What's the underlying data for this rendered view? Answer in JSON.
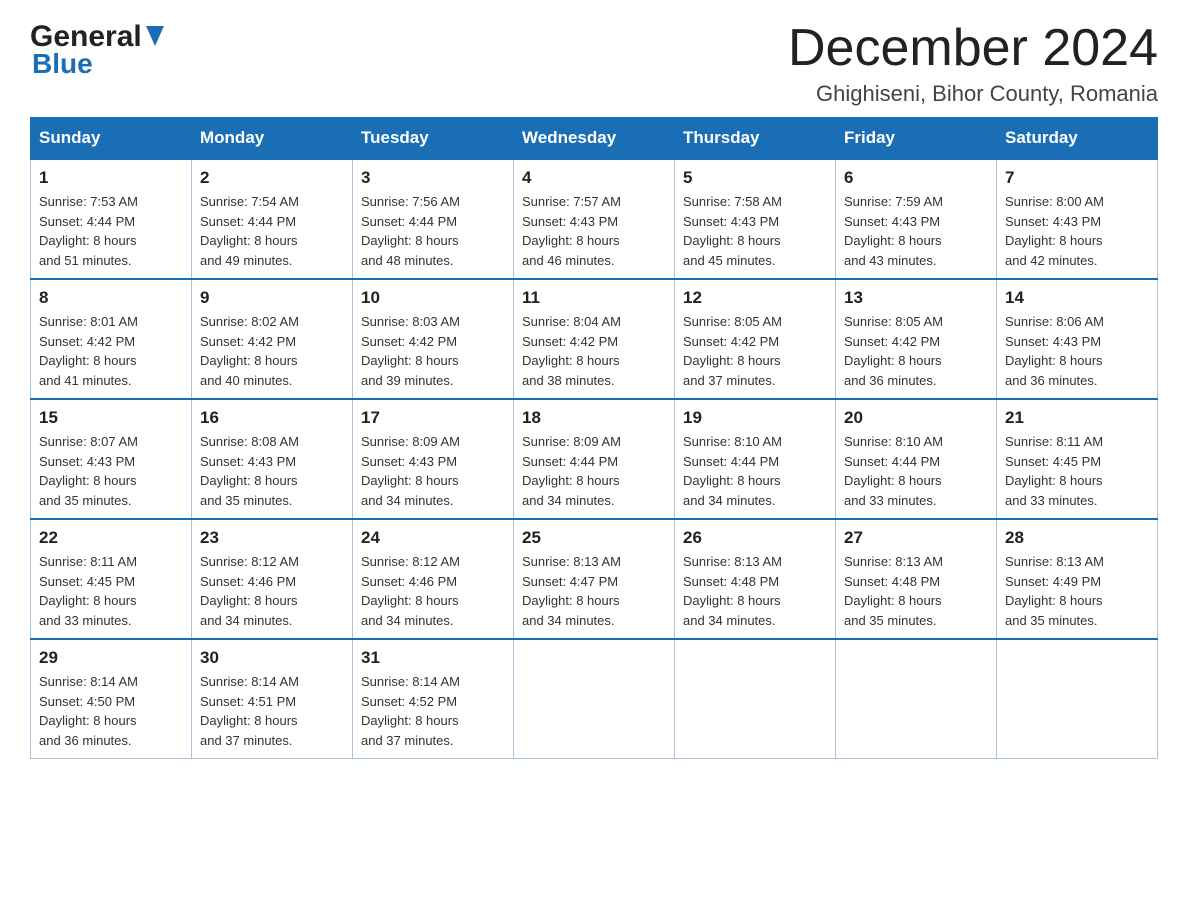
{
  "header": {
    "logo_general": "General",
    "logo_blue": "Blue",
    "month_title": "December 2024",
    "location": "Ghighiseni, Bihor County, Romania"
  },
  "weekdays": [
    "Sunday",
    "Monday",
    "Tuesday",
    "Wednesday",
    "Thursday",
    "Friday",
    "Saturday"
  ],
  "weeks": [
    [
      {
        "day": "1",
        "sunrise": "7:53 AM",
        "sunset": "4:44 PM",
        "daylight": "8 hours and 51 minutes."
      },
      {
        "day": "2",
        "sunrise": "7:54 AM",
        "sunset": "4:44 PM",
        "daylight": "8 hours and 49 minutes."
      },
      {
        "day": "3",
        "sunrise": "7:56 AM",
        "sunset": "4:44 PM",
        "daylight": "8 hours and 48 minutes."
      },
      {
        "day": "4",
        "sunrise": "7:57 AM",
        "sunset": "4:43 PM",
        "daylight": "8 hours and 46 minutes."
      },
      {
        "day": "5",
        "sunrise": "7:58 AM",
        "sunset": "4:43 PM",
        "daylight": "8 hours and 45 minutes."
      },
      {
        "day": "6",
        "sunrise": "7:59 AM",
        "sunset": "4:43 PM",
        "daylight": "8 hours and 43 minutes."
      },
      {
        "day": "7",
        "sunrise": "8:00 AM",
        "sunset": "4:43 PM",
        "daylight": "8 hours and 42 minutes."
      }
    ],
    [
      {
        "day": "8",
        "sunrise": "8:01 AM",
        "sunset": "4:42 PM",
        "daylight": "8 hours and 41 minutes."
      },
      {
        "day": "9",
        "sunrise": "8:02 AM",
        "sunset": "4:42 PM",
        "daylight": "8 hours and 40 minutes."
      },
      {
        "day": "10",
        "sunrise": "8:03 AM",
        "sunset": "4:42 PM",
        "daylight": "8 hours and 39 minutes."
      },
      {
        "day": "11",
        "sunrise": "8:04 AM",
        "sunset": "4:42 PM",
        "daylight": "8 hours and 38 minutes."
      },
      {
        "day": "12",
        "sunrise": "8:05 AM",
        "sunset": "4:42 PM",
        "daylight": "8 hours and 37 minutes."
      },
      {
        "day": "13",
        "sunrise": "8:05 AM",
        "sunset": "4:42 PM",
        "daylight": "8 hours and 36 minutes."
      },
      {
        "day": "14",
        "sunrise": "8:06 AM",
        "sunset": "4:43 PM",
        "daylight": "8 hours and 36 minutes."
      }
    ],
    [
      {
        "day": "15",
        "sunrise": "8:07 AM",
        "sunset": "4:43 PM",
        "daylight": "8 hours and 35 minutes."
      },
      {
        "day": "16",
        "sunrise": "8:08 AM",
        "sunset": "4:43 PM",
        "daylight": "8 hours and 35 minutes."
      },
      {
        "day": "17",
        "sunrise": "8:09 AM",
        "sunset": "4:43 PM",
        "daylight": "8 hours and 34 minutes."
      },
      {
        "day": "18",
        "sunrise": "8:09 AM",
        "sunset": "4:44 PM",
        "daylight": "8 hours and 34 minutes."
      },
      {
        "day": "19",
        "sunrise": "8:10 AM",
        "sunset": "4:44 PM",
        "daylight": "8 hours and 34 minutes."
      },
      {
        "day": "20",
        "sunrise": "8:10 AM",
        "sunset": "4:44 PM",
        "daylight": "8 hours and 33 minutes."
      },
      {
        "day": "21",
        "sunrise": "8:11 AM",
        "sunset": "4:45 PM",
        "daylight": "8 hours and 33 minutes."
      }
    ],
    [
      {
        "day": "22",
        "sunrise": "8:11 AM",
        "sunset": "4:45 PM",
        "daylight": "8 hours and 33 minutes."
      },
      {
        "day": "23",
        "sunrise": "8:12 AM",
        "sunset": "4:46 PM",
        "daylight": "8 hours and 34 minutes."
      },
      {
        "day": "24",
        "sunrise": "8:12 AM",
        "sunset": "4:46 PM",
        "daylight": "8 hours and 34 minutes."
      },
      {
        "day": "25",
        "sunrise": "8:13 AM",
        "sunset": "4:47 PM",
        "daylight": "8 hours and 34 minutes."
      },
      {
        "day": "26",
        "sunrise": "8:13 AM",
        "sunset": "4:48 PM",
        "daylight": "8 hours and 34 minutes."
      },
      {
        "day": "27",
        "sunrise": "8:13 AM",
        "sunset": "4:48 PM",
        "daylight": "8 hours and 35 minutes."
      },
      {
        "day": "28",
        "sunrise": "8:13 AM",
        "sunset": "4:49 PM",
        "daylight": "8 hours and 35 minutes."
      }
    ],
    [
      {
        "day": "29",
        "sunrise": "8:14 AM",
        "sunset": "4:50 PM",
        "daylight": "8 hours and 36 minutes."
      },
      {
        "day": "30",
        "sunrise": "8:14 AM",
        "sunset": "4:51 PM",
        "daylight": "8 hours and 37 minutes."
      },
      {
        "day": "31",
        "sunrise": "8:14 AM",
        "sunset": "4:52 PM",
        "daylight": "8 hours and 37 minutes."
      },
      null,
      null,
      null,
      null
    ]
  ],
  "labels": {
    "sunrise": "Sunrise: ",
    "sunset": "Sunset: ",
    "daylight": "Daylight: "
  }
}
